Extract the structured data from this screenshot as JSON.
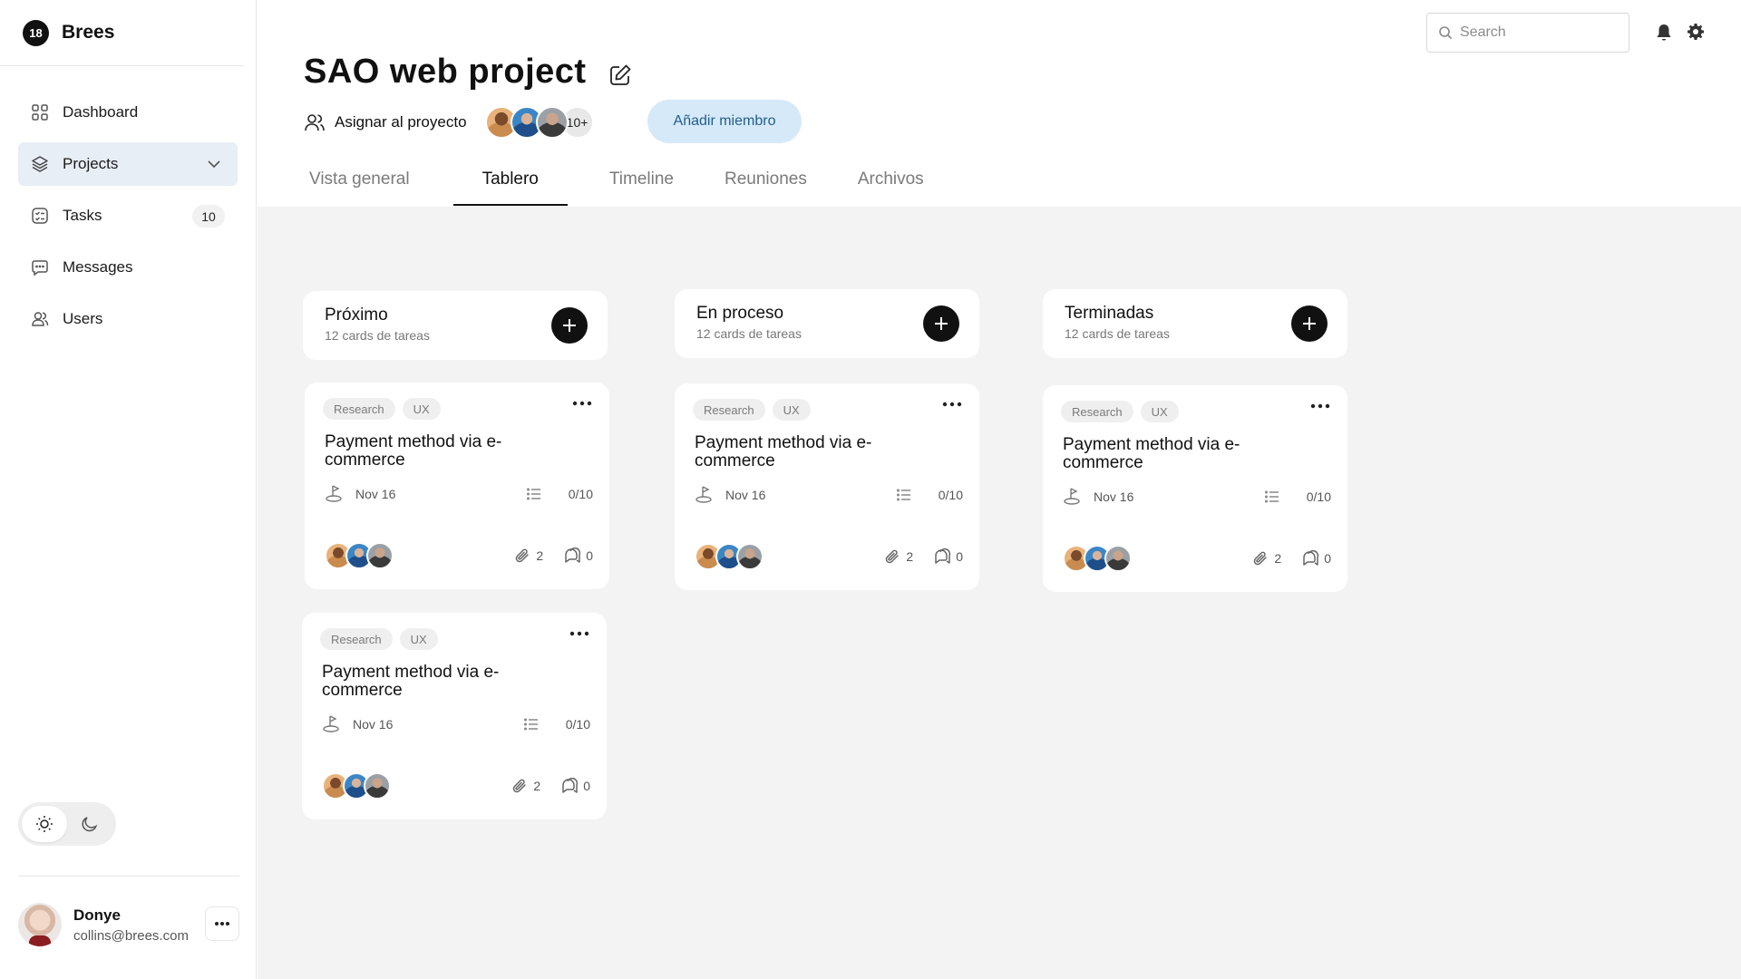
{
  "brand": {
    "logo_text": "18",
    "name": "Brees"
  },
  "nav": {
    "items": [
      {
        "label": "Dashboard",
        "icon": "grid-icon"
      },
      {
        "label": "Projects",
        "icon": "layers-icon",
        "active": true
      },
      {
        "label": "Tasks",
        "icon": "checklist-icon",
        "badge": "10"
      },
      {
        "label": "Messages",
        "icon": "chat-icon"
      },
      {
        "label": "Users",
        "icon": "users-icon"
      }
    ]
  },
  "theme": {
    "selected": "light"
  },
  "profile": {
    "name": "Donye",
    "email": "collins@brees.com"
  },
  "search": {
    "placeholder": "Search"
  },
  "project": {
    "title": "SAO web project",
    "assign_label": "Asignar al proyecto",
    "avatars_more": "10+",
    "add_member_label": "Añadir miembro"
  },
  "tabs": [
    {
      "label": "Vista general"
    },
    {
      "label": "Tablero",
      "active": true
    },
    {
      "label": "Timeline"
    },
    {
      "label": "Reuniones"
    },
    {
      "label": "Archivos"
    }
  ],
  "columns": [
    {
      "title": "Próximo",
      "subtitle": "12 cards de tareas"
    },
    {
      "title": "En proceso",
      "subtitle": "12 cards de tareas"
    },
    {
      "title": "Terminadas",
      "subtitle": "12 cards de tareas"
    }
  ],
  "cards": [
    {
      "tags": [
        "Research",
        "UX"
      ],
      "title": "Payment method via e-commerce",
      "date": "Nov 16",
      "progress": "0/10",
      "attachments": "2",
      "comments": "0"
    },
    {
      "tags": [
        "Research",
        "UX"
      ],
      "title": "Payment method via e-commerce",
      "date": "Nov 16",
      "progress": "0/10",
      "attachments": "2",
      "comments": "0"
    },
    {
      "tags": [
        "Research",
        "UX"
      ],
      "title": "Payment method via e-commerce",
      "date": "Nov 16",
      "progress": "0/10",
      "attachments": "2",
      "comments": "0"
    },
    {
      "tags": [
        "Research",
        "UX"
      ],
      "title": "Payment method via e-commerce",
      "date": "Nov 16",
      "progress": "0/10",
      "attachments": "2",
      "comments": "0"
    }
  ],
  "colors": {
    "accent_bg": "#d6e9f8",
    "accent_text": "#1f5d8e",
    "active_nav_bg": "#e8eef6",
    "board_bg": "#f3f3f3"
  }
}
